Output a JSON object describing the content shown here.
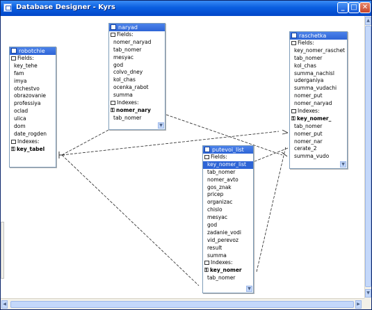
{
  "window": {
    "title": "Database Designer - Kyrs",
    "minimize": "_",
    "maximize": "□",
    "close": "✕"
  },
  "tables": [
    {
      "name": "robotchie",
      "rows": [
        "Fields:",
        "key_tehe",
        "fam",
        "imya",
        "otchestvo",
        "obrazovanie",
        "professiya",
        "oclad",
        "ulica",
        "dom",
        "date_rogden",
        "Indexes:",
        "key_tabel"
      ]
    },
    {
      "name": "naryad",
      "rows": [
        "Fields:",
        "nomer_naryad",
        "tab_nomer",
        "mesyac",
        "god",
        "colvo_dney",
        "kol_chas",
        "ocenka_rabot",
        "summa",
        "Indexes:",
        "nomer_nary",
        "tab_nomer"
      ]
    },
    {
      "name": "raschetka",
      "rows": [
        "Fields:",
        "key_nomer_raschet",
        "tab_nomer",
        "kol_chas",
        "summa_nachisl",
        "uderganiya",
        "summa_vudachi",
        "nomer_put",
        "nomer_naryad",
        "Indexes:",
        "key_nomer_",
        "tab_nomer",
        "nomer_put",
        "nomer_nar",
        "cerate_2",
        "summa_vudo"
      ]
    },
    {
      "name": "putevoi_list",
      "rows": [
        "Fields:",
        "key_nomer_list",
        "tab_nomer",
        "nomer_avto",
        "gos_znak",
        "pricep",
        "organizac",
        "chislo",
        "mesyac",
        "god",
        "zadanie_vodi",
        "vid_perevoz",
        "result",
        "summa",
        "Indexes:",
        "key_nomer",
        "tab_nomer"
      ]
    }
  ],
  "icons": {
    "window": "app-icon",
    "table": "table-icon",
    "fields": "fields-icon",
    "indexes": "indexes-icon",
    "key": "key-icon"
  }
}
